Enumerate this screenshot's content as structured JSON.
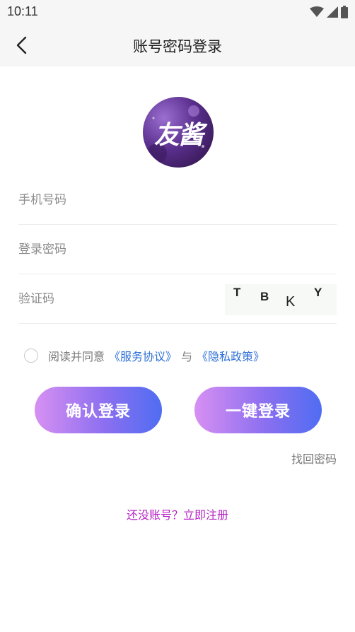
{
  "status_bar": {
    "time": "10:11"
  },
  "nav": {
    "title": "账号密码登录"
  },
  "logo": {
    "text": "友酱"
  },
  "form": {
    "phone_placeholder": "手机号码",
    "password_placeholder": "登录密码",
    "captcha_placeholder": "验证码",
    "captcha_chars": [
      "T",
      "B",
      "K",
      "Y"
    ]
  },
  "agreement": {
    "prefix": "阅读并同意",
    "service_link": "《服务协议》",
    "and": "与",
    "privacy_link": "《隐私政策》"
  },
  "buttons": {
    "confirm_login": "确认登录",
    "one_key_login": "一键登录"
  },
  "links": {
    "forgot_password": "找回密码",
    "register": "还没账号？立即注册"
  },
  "colors": {
    "accent_link": "#2d6fd6",
    "register": "#b521c4",
    "button_start": "#d790f2",
    "button_end": "#4f6df2"
  }
}
